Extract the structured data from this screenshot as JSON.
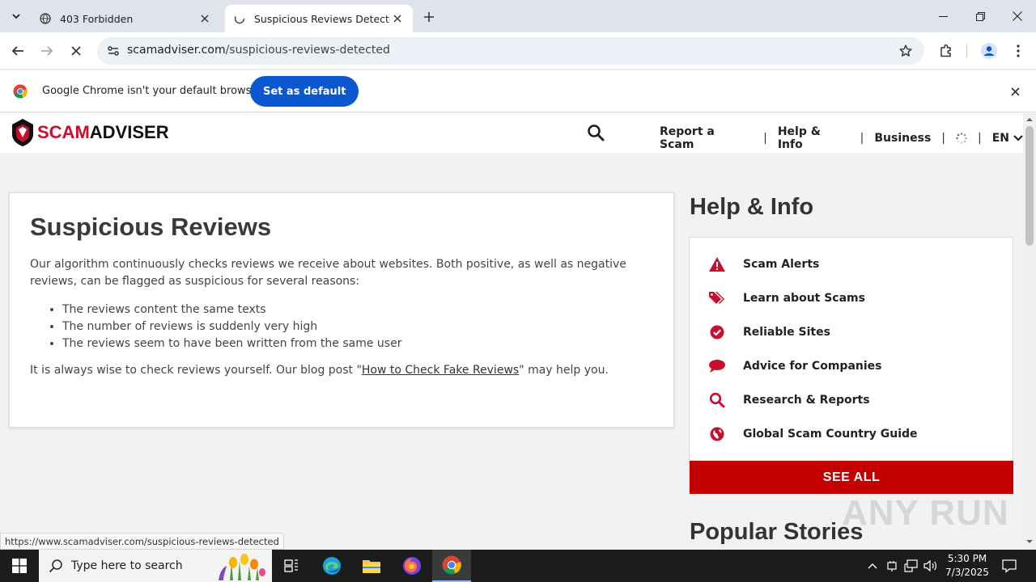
{
  "browser": {
    "tabs": [
      {
        "title": "403 Forbidden",
        "active": false
      },
      {
        "title": "Suspicious Reviews Detected - S",
        "active": true
      }
    ],
    "url_domain": "scamadviser.com",
    "url_path": "/suspicious-reviews-detected",
    "infobar": {
      "message": "Google Chrome isn't your default browser",
      "button": "Set as default"
    },
    "status_url": "https://www.scamadviser.com/suspicious-reviews-detected"
  },
  "site": {
    "logo": {
      "part1": "SCAM",
      "part2": "ADVISER"
    },
    "nav": [
      {
        "label": "Report a Scam"
      },
      {
        "label": "Help & Info"
      },
      {
        "label": "Business"
      }
    ],
    "language": "EN",
    "brand_color": "#c8102e"
  },
  "article": {
    "title": "Suspicious Reviews",
    "intro": "Our algorithm continuously checks reviews we receive about websites. Both positive, as well as negative reviews, can be flagged as suspicious for several reasons:",
    "reasons": [
      "The reviews content the same texts",
      "The number of reviews is suddenly very high",
      "The reviews seem to have been written from the same user"
    ],
    "outro_before": "It is always wise to check reviews yourself. Our blog post \"",
    "outro_link": "How to Check Fake Reviews",
    "outro_after": "\" may help you."
  },
  "sidebar": {
    "title": "Help & Info",
    "items": [
      {
        "label": "Scam Alerts",
        "icon": "warning-icon"
      },
      {
        "label": "Learn about Scams",
        "icon": "tags-icon"
      },
      {
        "label": "Reliable Sites",
        "icon": "check-circle-icon"
      },
      {
        "label": "Advice for Companies",
        "icon": "speech-bubble-icon"
      },
      {
        "label": "Research & Reports",
        "icon": "search-icon"
      },
      {
        "label": "Global Scam Country Guide",
        "icon": "globe-icon"
      }
    ],
    "see_all": "SEE ALL",
    "popular_title": "Popular Stories"
  },
  "watermark": "ANY RUN",
  "taskbar": {
    "search_placeholder": "Type here to search",
    "time": "5:30 PM",
    "date": "7/3/2025"
  }
}
